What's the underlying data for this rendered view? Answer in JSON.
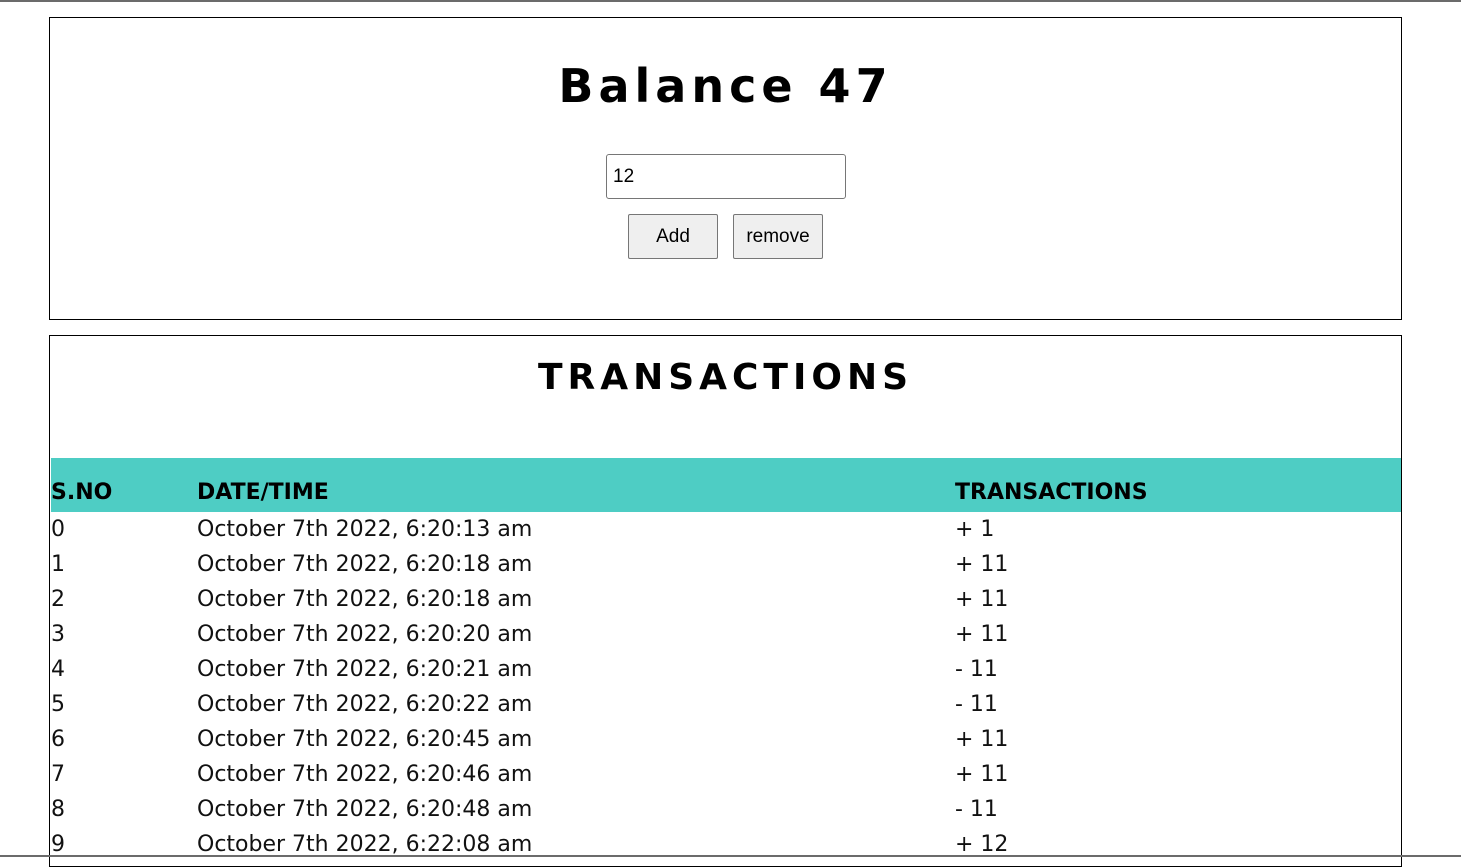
{
  "balance": {
    "title": "Balance 47",
    "input_value": "12",
    "add_label": "Add",
    "remove_label": "remove"
  },
  "transactions": {
    "title": "TRANSACTIONS",
    "columns": [
      "S.NO",
      "DATE/TIME",
      "TRANSACTIONS"
    ],
    "rows": [
      {
        "sno": "0",
        "datetime": "October 7th 2022, 6:20:13 am",
        "amount": "+ 1"
      },
      {
        "sno": "1",
        "datetime": "October 7th 2022, 6:20:18 am",
        "amount": "+ 11"
      },
      {
        "sno": "2",
        "datetime": "October 7th 2022, 6:20:18 am",
        "amount": "+ 11"
      },
      {
        "sno": "3",
        "datetime": "October 7th 2022, 6:20:20 am",
        "amount": "+ 11"
      },
      {
        "sno": "4",
        "datetime": "October 7th 2022, 6:20:21 am",
        "amount": "- 11"
      },
      {
        "sno": "5",
        "datetime": "October 7th 2022, 6:20:22 am",
        "amount": "- 11"
      },
      {
        "sno": "6",
        "datetime": "October 7th 2022, 6:20:45 am",
        "amount": "+ 11"
      },
      {
        "sno": "7",
        "datetime": "October 7th 2022, 6:20:46 am",
        "amount": "+ 11"
      },
      {
        "sno": "8",
        "datetime": "October 7th 2022, 6:20:48 am",
        "amount": "- 11"
      },
      {
        "sno": "9",
        "datetime": "October 7th 2022, 6:22:08 am",
        "amount": "+ 12"
      }
    ]
  },
  "colors": {
    "header_bg": "#4ecdc4",
    "border": "#000000",
    "button_bg": "#efefef"
  }
}
